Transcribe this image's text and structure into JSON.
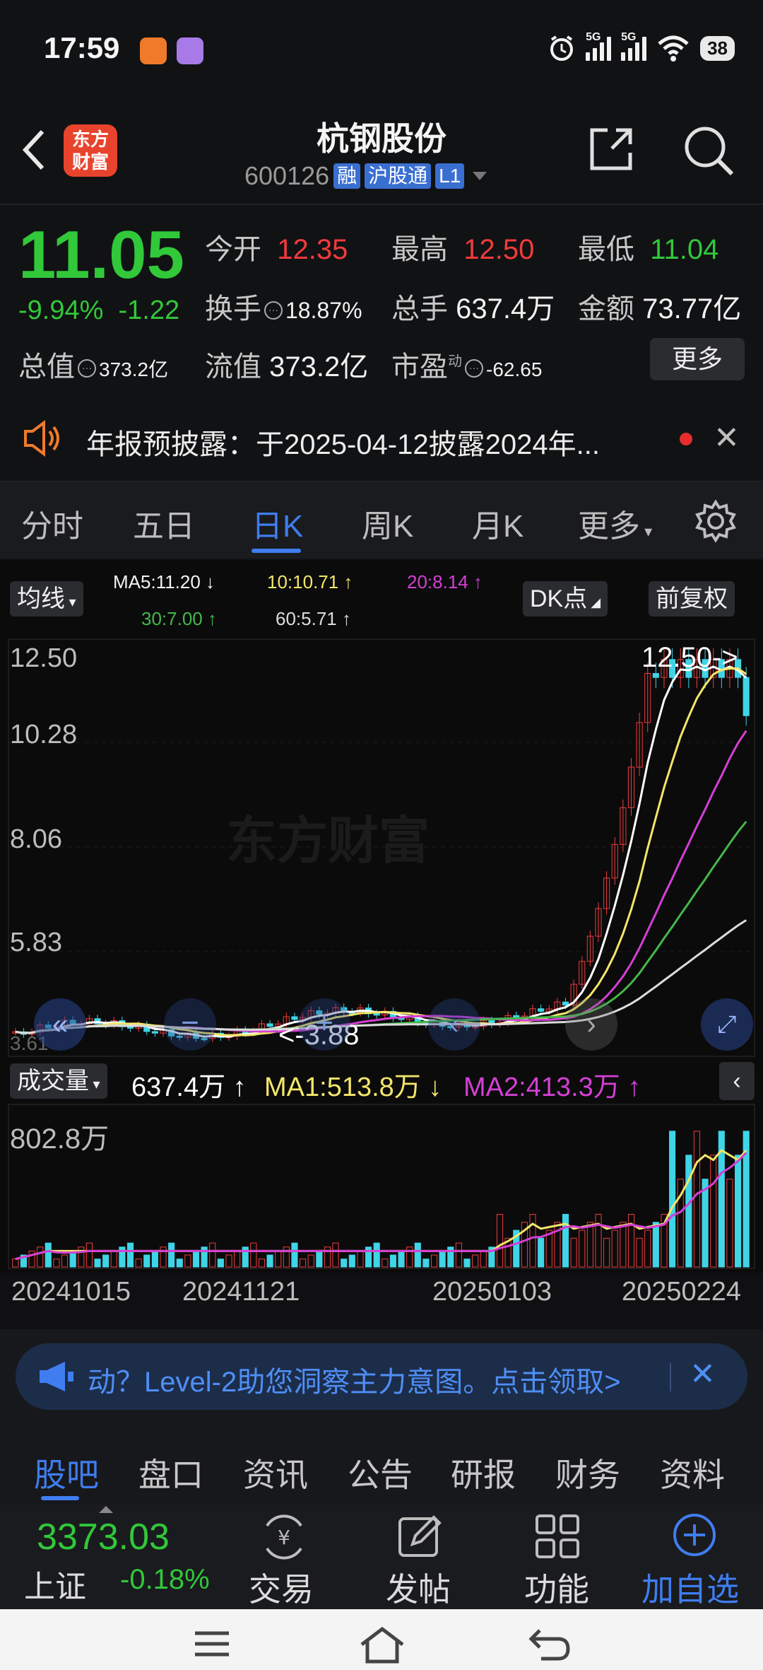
{
  "status_bar": {
    "time": "17:59",
    "network1": "5G",
    "network2": "5G",
    "battery": "38"
  },
  "header": {
    "title": "杭钢股份",
    "code": "600126",
    "tags": [
      "融",
      "沪股通",
      "L1"
    ],
    "logo_text_1": "东方",
    "logo_text_2": "财富"
  },
  "quote": {
    "price": "11.05",
    "change_pct": "-9.94%",
    "change": "-1.22",
    "open_label": "今开",
    "open": "12.35",
    "high_label": "最高",
    "high": "12.50",
    "low_label": "最低",
    "low": "11.04",
    "turnover_label": "换手",
    "turnover": "18.87%",
    "volume_label": "总手",
    "volume": "637.4万",
    "amount_label": "金额",
    "amount": "73.77亿",
    "mktcap_label": "总值",
    "mktcap": "373.2亿",
    "float_label": "流值",
    "float": "373.2亿",
    "pe_label": "市盈",
    "pe_sup": "动",
    "pe": "-62.65",
    "more": "更多"
  },
  "notice": {
    "text": "年报预披露：于2025-04-12披露2024年..."
  },
  "tabs": {
    "items": [
      "分时",
      "五日",
      "日K",
      "周K",
      "月K",
      "更多"
    ],
    "active": 2
  },
  "chart": {
    "ma_button": "均线",
    "ma5": "MA5:11.20 ↓",
    "ma10": "10:10.71 ↑",
    "ma20": "20:8.14 ↑",
    "ma30": "30:7.00 ↑",
    "ma60": "60:5.71 ↑",
    "dk_button": "DK点",
    "adjust_button": "前复权",
    "max_label": "12.50->",
    "min_label": "<-3.88",
    "watermark": "东方财富",
    "y_ticks": [
      "12.50",
      "10.28",
      "8.06",
      "5.83",
      "3.61"
    ],
    "vol_button": "成交量",
    "vol_value": "637.4万 ↑",
    "vol_ma1": "MA1:513.8万 ↓",
    "vol_ma2": "MA2:413.3万 ↑",
    "vol_axis": "802.8万",
    "x_dates": [
      "20241015",
      "20241121",
      "20250103",
      "20250224"
    ],
    "colors": {
      "up": "#f23b3b",
      "down": "#3fd4e6",
      "ma5": "#ffffff",
      "ma10": "#f3e66a",
      "ma20": "#d43fd4",
      "ma30": "#44b84a",
      "ma60": "#dcdcdc"
    }
  },
  "chart_data": {
    "type": "candlestick",
    "x": [
      "20241015",
      "20241121",
      "20250103",
      "20250224"
    ],
    "ylim": [
      3.61,
      12.5
    ],
    "last_close": 11.05,
    "period_high": 12.5,
    "period_low": 3.88,
    "series": [
      {
        "name": "MA5",
        "values": [
          11.2
        ]
      },
      {
        "name": "MA10",
        "values": [
          10.71
        ]
      },
      {
        "name": "MA20",
        "values": [
          8.14
        ]
      },
      {
        "name": "MA30",
        "values": [
          7.0
        ]
      },
      {
        "name": "MA60",
        "values": [
          5.71
        ]
      }
    ],
    "volume": {
      "last": "637.4万",
      "ma1": "513.8万",
      "ma2": "413.3万",
      "ymax": "802.8万"
    }
  },
  "banner": {
    "text": "动？Level-2助您洞察主力意图。点击领取>"
  },
  "lower_tabs": {
    "items": [
      "股吧",
      "盘口",
      "资讯",
      "公告",
      "研报",
      "财务",
      "资料"
    ],
    "active": 0
  },
  "bottom_bar": {
    "index_value": "3373.03",
    "index_name": "上证",
    "index_change": "-0.18%",
    "trade": "交易",
    "post": "发帖",
    "function": "功能",
    "add_watch": "加自选"
  }
}
